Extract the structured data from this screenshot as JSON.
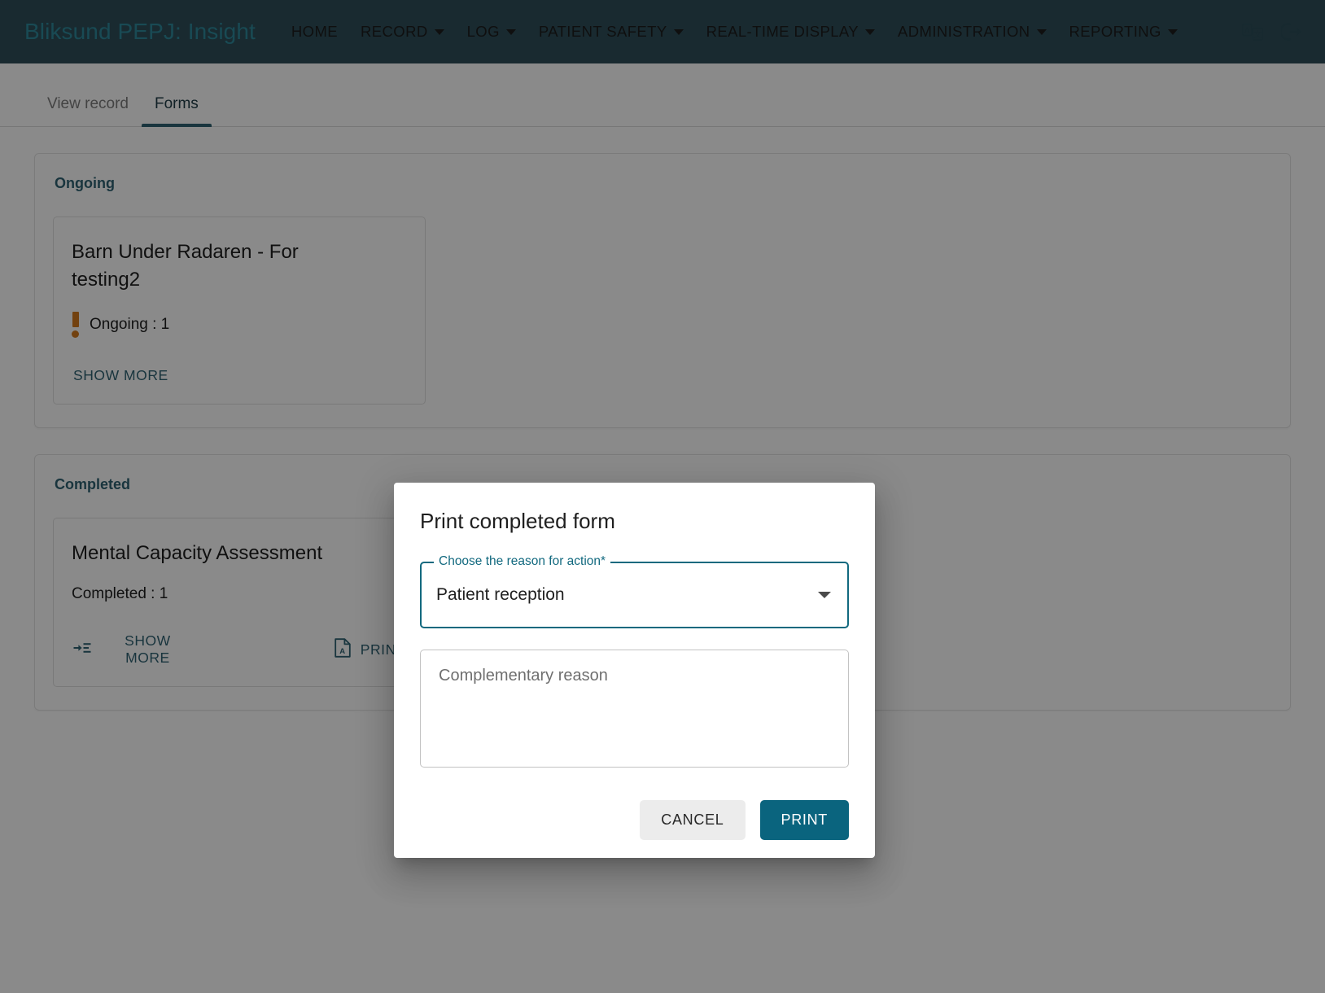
{
  "navbar": {
    "brand": "Bliksund PEPJ: Insight",
    "items": [
      {
        "label": "HOME",
        "has_caret": false
      },
      {
        "label": "RECORD",
        "has_caret": true
      },
      {
        "label": "LOG",
        "has_caret": true
      },
      {
        "label": "PATIENT SAFETY",
        "has_caret": true
      },
      {
        "label": "REAL-TIME DISPLAY",
        "has_caret": true
      },
      {
        "label": "ADMINISTRATION",
        "has_caret": true
      },
      {
        "label": "REPORTING",
        "has_caret": true
      }
    ],
    "icons": [
      {
        "name": "translate-icon",
        "glyph": "A文"
      },
      {
        "name": "logout-icon",
        "glyph": "[→"
      }
    ],
    "background_color": "#2f4f5a",
    "brand_color": "#2f8a9b"
  },
  "tabs": [
    {
      "label": "View record",
      "active": false
    },
    {
      "label": "Forms",
      "active": true
    }
  ],
  "sections": [
    {
      "title": "Ongoing",
      "card": {
        "title": "Barn Under Radaren - For testing2",
        "status_icon": "priority-high-icon",
        "status_text": "Ongoing : 1",
        "status_color": "#d2791d",
        "actions": [
          {
            "label": "SHOW MORE",
            "icon": ""
          }
        ]
      }
    },
    {
      "title": "Completed",
      "card": {
        "title": "Mental Capacity Assessment",
        "status_icon": "",
        "status_text": "Completed : 1",
        "status_color": "",
        "actions": [
          {
            "label": "SHOW MORE",
            "icon": "show-more-icon"
          },
          {
            "label": "PRINT",
            "icon": "pdf-file-icon"
          }
        ]
      }
    }
  ],
  "dialog": {
    "title": "Print completed form",
    "select": {
      "label": "Choose the reason for action*",
      "value": "Patient reception",
      "options": [
        "Patient reception"
      ],
      "accent_color": "#12697f"
    },
    "textarea": {
      "placeholder": "Complementary reason",
      "value": ""
    },
    "cancel_label": "CANCEL",
    "print_label": "PRINT",
    "print_color": "#0a647e"
  }
}
